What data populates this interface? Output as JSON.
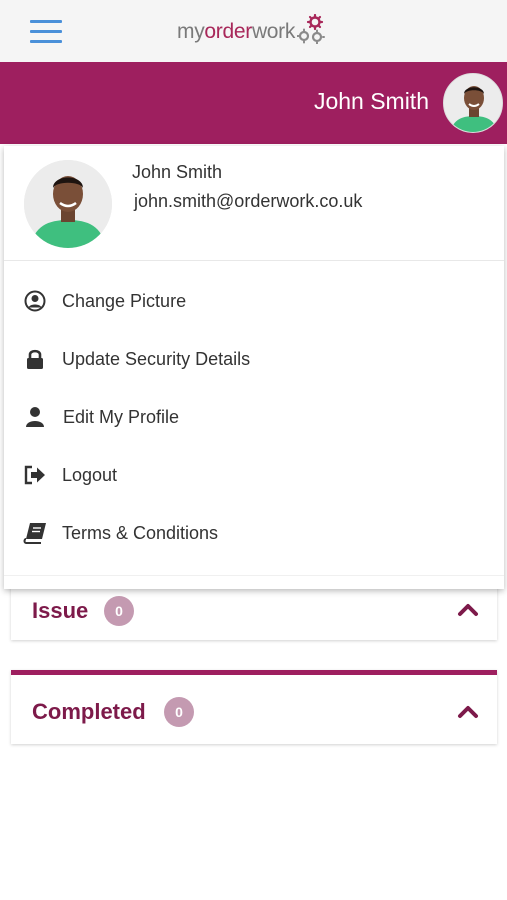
{
  "header": {
    "logo": {
      "part1": "my",
      "part2": "order",
      "part3": "work"
    },
    "menu_icon": "hamburger-icon"
  },
  "userbar": {
    "name": "John Smith",
    "avatar": "profile-avatar"
  },
  "profile_menu": {
    "name": "John Smith",
    "email": "john.smith@orderwork.co.uk",
    "items": [
      {
        "label": "Change Picture",
        "icon": "user-circle-icon"
      },
      {
        "label": "Update Security Details",
        "icon": "lock-icon"
      },
      {
        "label": "Edit My Profile",
        "icon": "user-icon"
      },
      {
        "label": "Logout",
        "icon": "sign-out-icon"
      },
      {
        "label": "Terms & Conditions",
        "icon": "book-icon"
      }
    ]
  },
  "sections": [
    {
      "title": "Issue",
      "count": "0",
      "expanded": true
    },
    {
      "title": "Completed",
      "count": "0",
      "expanded": true
    }
  ],
  "colors": {
    "brand": "#9e1f5f",
    "section_title": "#7d1a4a",
    "badge": "#c49ab1",
    "menu_icon": "#4a90d9"
  }
}
